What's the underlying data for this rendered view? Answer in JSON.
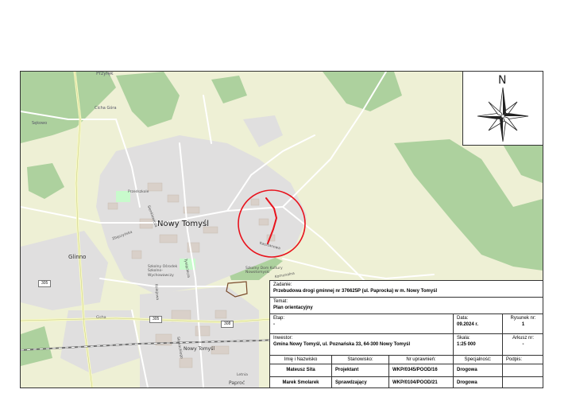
{
  "map": {
    "place_labels": [
      {
        "text": "Przyłęk"
      },
      {
        "text": "Sękowo"
      },
      {
        "text": "Cicha Góra"
      },
      {
        "text": "Nowy Tomyśl"
      },
      {
        "text": "Glinno"
      },
      {
        "text": "Nowy Tomyśl"
      },
      {
        "text": "Paproć"
      },
      {
        "text": "Zbąszyńska"
      },
      {
        "text": "Sienkiewicza"
      },
      {
        "text": "Tysiąclecia"
      },
      {
        "text": "Kolejowa"
      },
      {
        "text": "Cicha"
      },
      {
        "text": "Letnia"
      },
      {
        "text": "Kasztanowa"
      },
      {
        "text": "Słowackiego"
      },
      {
        "text": "Komunalna"
      }
    ],
    "poi_labels": [
      {
        "text": "Szkolny Dom Kultury Nowotomyski"
      },
      {
        "text": "Szkolny Ośrodek Szkolno-Wychowawczy"
      },
      {
        "text": "Przedszkole"
      }
    ],
    "road_shields": [
      "305",
      "308",
      "305"
    ],
    "colors": {
      "background": "#f2efe9",
      "forest": "#add19e",
      "farmland": "#eef0d5",
      "residential": "#e0dfdf",
      "building": "#d9d0c9",
      "road": "#ffffff",
      "main_road": "#f7fabf",
      "railway": "#707070",
      "marker": "#e8121c",
      "parcel": "#7a4a2a"
    }
  },
  "compass": {
    "north_label": "N"
  },
  "title_block": {
    "zadanie": {
      "label": "Zadanie:",
      "value": "Przebudowa drogi gminnej nr 376625P (ul. Paprocka) w m. Nowy Tomyśl"
    },
    "temat": {
      "label": "Temat:",
      "value": "Plan orientacyjny"
    },
    "etap": {
      "label": "Etap:",
      "value": "-"
    },
    "data": {
      "label": "Data:",
      "value": "09.2024 r."
    },
    "rysunek": {
      "label": "Rysunek nr:",
      "value": "1"
    },
    "inwestor": {
      "label": "Inwestor:",
      "value": "Gmina Nowy Tomyśl, ul. Poznańska 33, 64-300 Nowy Tomyśl"
    },
    "skala": {
      "label": "Skala:",
      "value": "1:25 000"
    },
    "arkusz": {
      "label": "Arkusz nr:",
      "value": "-"
    },
    "headers": {
      "name": "Imię i Nazwisko",
      "position": "Stanowisko:",
      "license": "Nr uprawnień:",
      "specialty": "Specjalność:",
      "signature": "Podpis:"
    },
    "people": [
      {
        "name": "Mateusz Sita",
        "position": "Projektant",
        "license": "WKP/0345/POOD/16",
        "specialty": "Drogowa"
      },
      {
        "name": "Marek Smolarek",
        "position": "Sprawdzający",
        "license": "WKP/0104/POOD/21",
        "specialty": "Drogowa"
      }
    ]
  }
}
